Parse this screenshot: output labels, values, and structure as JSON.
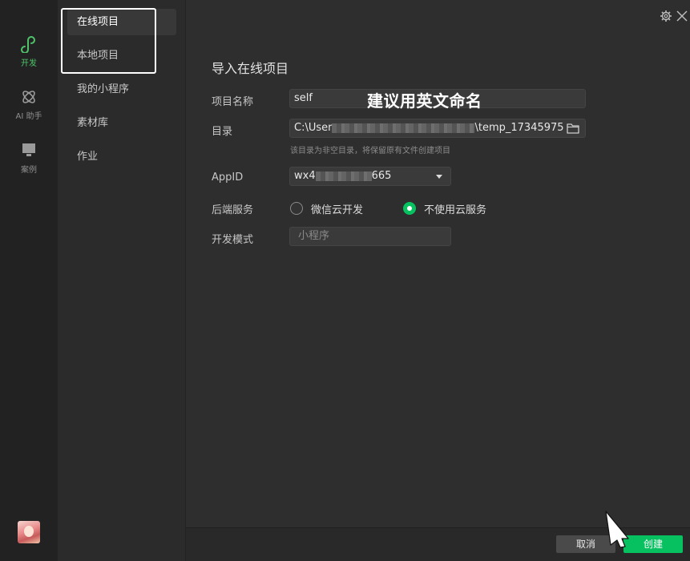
{
  "rail": {
    "items": [
      {
        "label": "开发",
        "icon": "mini-program-icon",
        "active": true
      },
      {
        "label": "AI 助手",
        "icon": "ai-assistant-icon",
        "active": false
      },
      {
        "label": "案例",
        "icon": "cases-icon",
        "active": false
      }
    ]
  },
  "nav": {
    "items": [
      {
        "label": "在线项目",
        "active": true
      },
      {
        "label": "本地项目",
        "active": false
      },
      {
        "label": "我的小程序",
        "active": false
      },
      {
        "label": "素材库",
        "active": false
      },
      {
        "label": "作业",
        "active": false
      }
    ]
  },
  "form": {
    "title": "导入在线项目",
    "project_name_label": "项目名称",
    "project_name_value": "self",
    "overlay_note": "建议用英文命名",
    "dir_label": "目录",
    "dir_prefix": "C:\\User",
    "dir_suffix": "\\temp_17345975",
    "dir_hint": "该目录为非空目录，将保留原有文件创建项目",
    "appid_label": "AppID",
    "appid_prefix": "wx4",
    "appid_suffix": "665",
    "backend_label": "后端服务",
    "backend_options": [
      {
        "label": "微信云开发",
        "selected": false
      },
      {
        "label": "不使用云服务",
        "selected": true
      }
    ],
    "mode_label": "开发模式",
    "mode_value": "小程序"
  },
  "footer": {
    "cancel_label": "取消",
    "create_label": "创建"
  },
  "colors": {
    "accent": "#07c160",
    "active_rail": "#4fc36a"
  }
}
